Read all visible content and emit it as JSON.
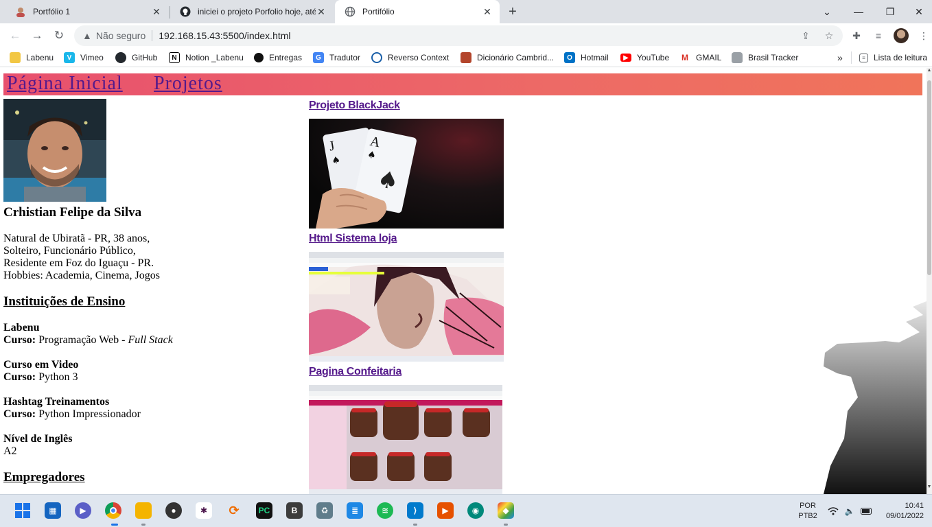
{
  "browser": {
    "tabs": [
      {
        "title": "Portfólio 1",
        "icon": "avatar-favicon"
      },
      {
        "title": "iniciei o projeto Porfolio hoje, até",
        "icon": "github-icon"
      },
      {
        "title": "Portifólio",
        "icon": "globe-icon"
      }
    ],
    "address": {
      "security_label": "Não seguro",
      "url": "192.168.15.43:5500/index.html"
    },
    "bookmarks": [
      {
        "label": "Labenu",
        "icon": "folder-icon",
        "color": "#f2c744"
      },
      {
        "label": "Vimeo",
        "icon": "vimeo-icon",
        "color": "#1ab7ea"
      },
      {
        "label": "GitHub",
        "icon": "github-icon",
        "color": "#24292e"
      },
      {
        "label": "Notion _Labenu",
        "icon": "notion-icon",
        "color": "#000000"
      },
      {
        "label": "Entregas",
        "icon": "circle-icon",
        "color": "#111111"
      },
      {
        "label": "Tradutor",
        "icon": "translate-icon",
        "color": "#4285f4"
      },
      {
        "label": "Reverso Context",
        "icon": "reverso-icon",
        "color": "#1a5fa8"
      },
      {
        "label": "Dicionário Cambrid...",
        "icon": "cambridge-icon",
        "color": "#b3452c"
      },
      {
        "label": "Hotmail",
        "icon": "outlook-icon",
        "color": "#0072c6"
      },
      {
        "label": "YouTube",
        "icon": "youtube-icon",
        "color": "#ff0000"
      },
      {
        "label": "GMAIL",
        "icon": "gmail-icon",
        "color": "#d93025"
      },
      {
        "label": "Brasil Tracker",
        "icon": "lock-icon",
        "color": "#9aa0a6"
      }
    ],
    "more_bookmarks": "»",
    "reading_list": "Lista de leitura"
  },
  "page": {
    "nav": {
      "home": "Página Inicial",
      "projects": "Projetos"
    },
    "profile": {
      "name": "Crhistian Felipe da Silva",
      "bio": [
        "Natural de Ubiratã - PR, 38 anos,",
        "Solteiro, Funcionário Público,",
        "Residente em Foz do Iguaçu - PR.",
        "Hobbies: Academia, Cinema, Jogos"
      ]
    },
    "education_title": "Instituições de Ensino",
    "course_label": "Curso:",
    "institutions": [
      {
        "name": "Labenu",
        "course": "Programação Web - ",
        "course_em": "Full Stack"
      },
      {
        "name": "Curso em Video",
        "course": "Python 3",
        "course_em": ""
      },
      {
        "name": "Hashtag Treinamentos",
        "course": "Python Impressionador",
        "course_em": ""
      }
    ],
    "english": {
      "label": "Nível de Inglês",
      "value": "A2"
    },
    "employers_title": "Empregadores",
    "projects": [
      {
        "title": "Projeto BlackJack"
      },
      {
        "title": "Html Sistema loja"
      },
      {
        "title": "Pagina Confeitaria"
      }
    ]
  },
  "taskbar": {
    "apps": [
      {
        "name": "start",
        "color": "#1a73e8"
      },
      {
        "name": "widgets",
        "color": "#1565c0"
      },
      {
        "name": "teams",
        "color": "#5b5fc7"
      },
      {
        "name": "chrome",
        "color": "#db4437"
      },
      {
        "name": "file-explorer",
        "color": "#f4b400"
      },
      {
        "name": "media",
        "color": "#333333"
      },
      {
        "name": "slack",
        "color": "#4a154b"
      },
      {
        "name": "arc",
        "color": "#ef6c00"
      },
      {
        "name": "pycharm",
        "color": "#21d789"
      },
      {
        "name": "bold",
        "color": "#3c3c3c"
      },
      {
        "name": "recycle",
        "color": "#607d8b"
      },
      {
        "name": "notepad",
        "color": "#1e88e5"
      },
      {
        "name": "spotify",
        "color": "#1db954"
      },
      {
        "name": "vscode",
        "color": "#007acc"
      },
      {
        "name": "video",
        "color": "#e65100"
      },
      {
        "name": "maps",
        "color": "#00897b"
      },
      {
        "name": "colors",
        "color": "#7cb342"
      }
    ],
    "lang": "POR",
    "layout": "PTB2",
    "time": "10:41",
    "date": "09/01/2022"
  }
}
